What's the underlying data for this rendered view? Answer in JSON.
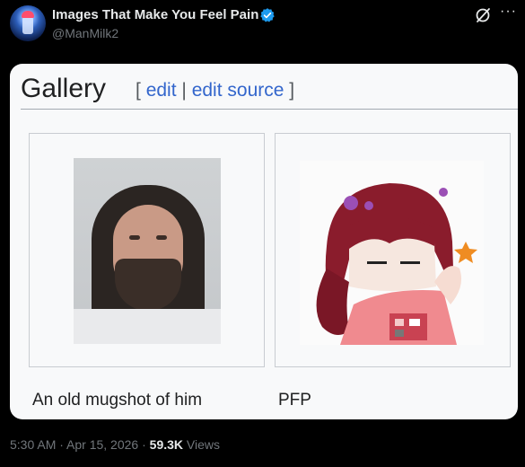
{
  "post": {
    "display_name": "Images That Make You Feel Pain",
    "handle": "@ManMilk2",
    "timestamp": "5:30 AM · Apr 15, 2026 · ",
    "views_count": "59.3K",
    "views_label": " Views",
    "icons": [
      "verified-badge-icon",
      "grok-icon",
      "more-options-icon"
    ],
    "verified_color": "#1d9bf0"
  },
  "wiki": {
    "heading": "Gallery",
    "bracket_open": "[",
    "edit": "edit",
    "separator": "|",
    "edit_source": "edit source",
    "bracket_close": "]",
    "link_color": "#3366cc",
    "gallery": [
      {
        "caption": "An old mugshot of him"
      },
      {
        "caption": "PFP"
      }
    ]
  }
}
